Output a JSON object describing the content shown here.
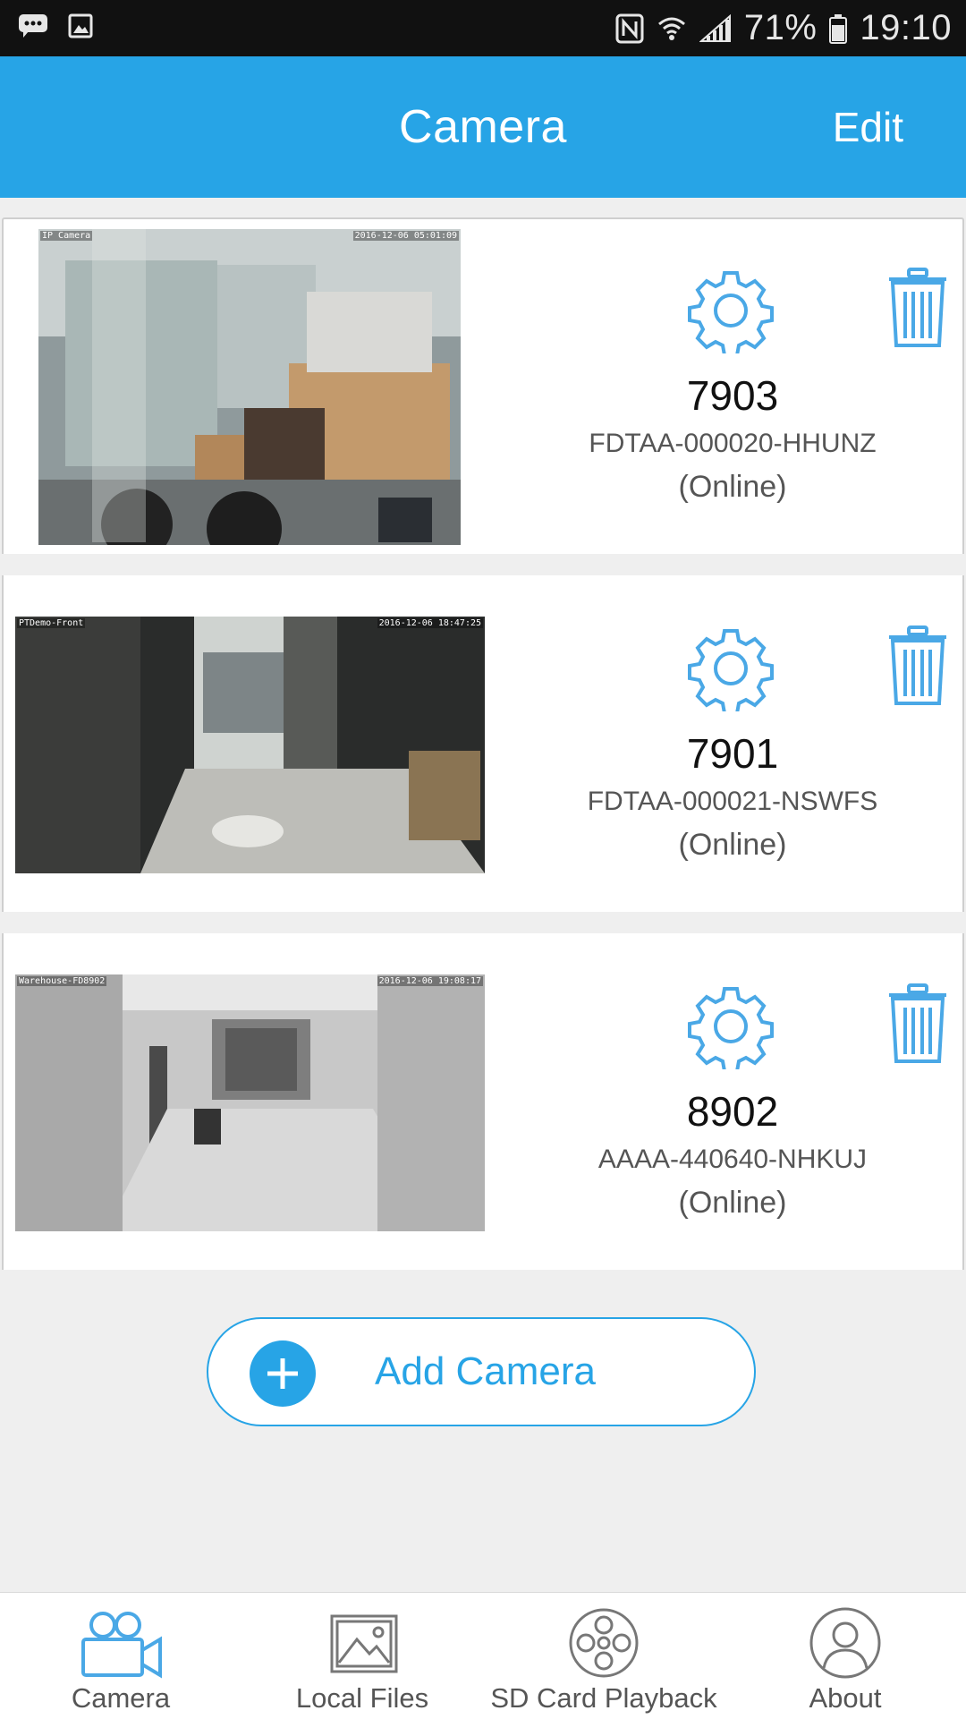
{
  "status_bar": {
    "battery": "71%",
    "time": "19:10",
    "icons": [
      "message-icon",
      "image-icon",
      "nfc-icon",
      "wifi-icon",
      "signal-icon",
      "battery-icon"
    ]
  },
  "app_bar": {
    "title": "Camera",
    "edit_label": "Edit"
  },
  "cameras": [
    {
      "name": "7903",
      "uid": "FDTAA-000020-HHUNZ",
      "status": "(Online)",
      "osd_title": "IP Camera",
      "osd_time": "2016-12-06 05:01:09"
    },
    {
      "name": "7901",
      "uid": "FDTAA-000021-NSWFS",
      "status": "(Online)",
      "osd_title": "PTDemo-Front",
      "osd_time": "2016-12-06 18:47:25"
    },
    {
      "name": "8902",
      "uid": "AAAA-440640-NHKUJ",
      "status": "(Online)",
      "osd_title": "Warehouse-FD8902",
      "osd_time": "2016-12-06 19:08:17"
    }
  ],
  "add_camera": {
    "label": "Add Camera"
  },
  "bottom_nav": [
    {
      "label": "Camera",
      "icon": "video-camera-icon",
      "active": true
    },
    {
      "label": "Local Files",
      "icon": "gallery-icon",
      "active": false
    },
    {
      "label": "SD Card Playback",
      "icon": "film-reel-icon",
      "active": false
    },
    {
      "label": "About",
      "icon": "person-icon",
      "active": false
    }
  ],
  "colors": {
    "accent": "#27a4e6",
    "icon_blue": "#4aa8e6",
    "background": "#efefef"
  }
}
